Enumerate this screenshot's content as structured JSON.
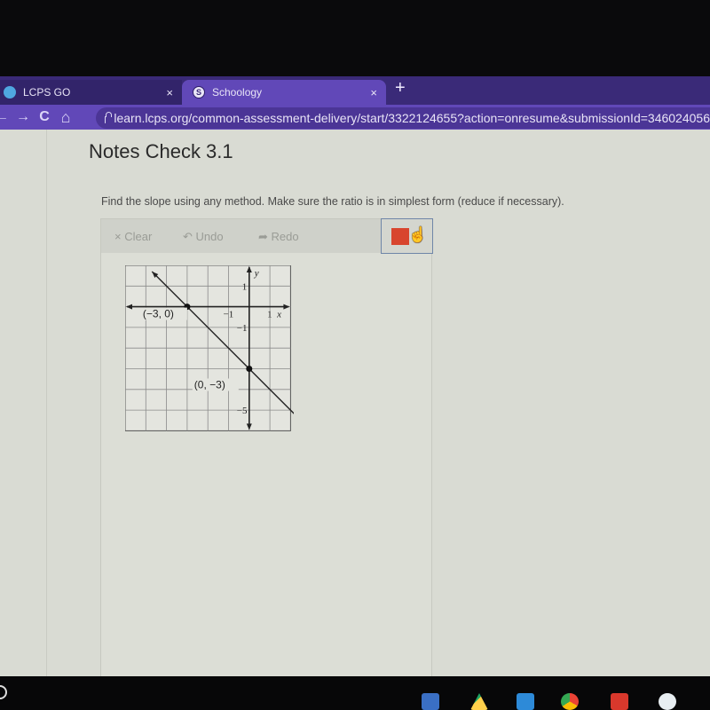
{
  "browser": {
    "tabs": [
      {
        "label": "LCPS GO",
        "active": false,
        "close": "×"
      },
      {
        "label": "Schoology",
        "active": true,
        "close": "×",
        "favicon": "S"
      }
    ],
    "new_tab": "+",
    "nav": {
      "back": "←",
      "forward": "→",
      "reload": "C",
      "home": "⌂"
    },
    "url": "learn.lcps.org/common-assessment-delivery/start/3322124655?action=onresume&submissionId=346024056",
    "accent": "#6148b8"
  },
  "page": {
    "title": "Notes Check 3.1",
    "prompt": "Find the slope using any method. Make sure the ratio is in simplest form (reduce if necessary).",
    "toolbar": {
      "clear_label": "× Clear",
      "undo_label": "↶ Undo",
      "redo_label": "➦ Redo",
      "selected_color": "#d8452e"
    },
    "graph": {
      "x_axis_label": "x",
      "y_axis_label": "y",
      "x_ticks": [
        "−1",
        "1"
      ],
      "y_ticks": [
        "1",
        "−1",
        "−5"
      ],
      "grid_x_range": [
        -6,
        2
      ],
      "grid_y_range": [
        -6,
        2
      ],
      "points": [
        {
          "label": "(−3, 0)",
          "x": -3,
          "y": 0
        },
        {
          "label": "(0, −3)",
          "x": 0,
          "y": -3
        }
      ],
      "line": {
        "slope": -1,
        "intercept": -3
      }
    }
  },
  "shelf": {
    "apps": [
      "lcps-go",
      "google-drive",
      "classroom",
      "chrome",
      "youtube",
      "play-store"
    ]
  }
}
